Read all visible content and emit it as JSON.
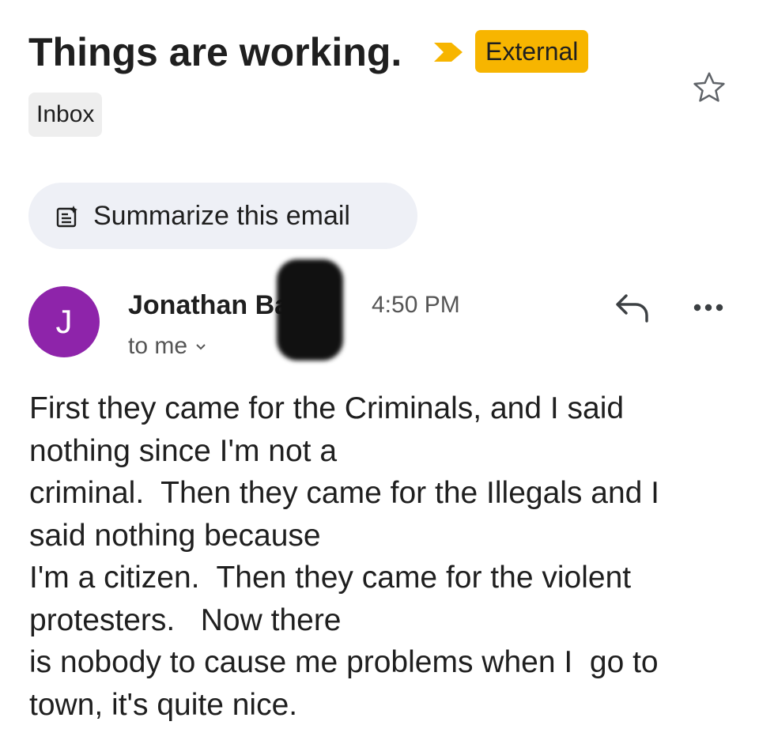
{
  "email": {
    "subject": "Things are working.",
    "importance_icon": "importance-marker-icon",
    "external_label": "External",
    "label_chip": "Inbox",
    "starred": false
  },
  "summarize": {
    "icon": "summarize-icon",
    "label": "Summarize this email"
  },
  "message": {
    "avatar_initial": "J",
    "avatar_color": "#8e24aa",
    "sender_name": "Jonathan Basile",
    "sender_redacted": true,
    "time": "4:50 PM",
    "recipient": "to me",
    "body_lines": [
      "First they came for the Criminals, and I said",
      "nothing since I'm not a",
      "criminal.  Then they came for the Illegals and I",
      "said nothing because",
      "I'm a citizen.  Then they came for the violent",
      "protesters.   Now there",
      "is nobody to cause me problems when I  go to",
      "town, it's quite nice."
    ]
  },
  "colors": {
    "external_badge": "#f7b500",
    "importance_marker": "#f7b500",
    "summarize_bg": "#eef0f6",
    "chip_bg": "#eeeeee"
  }
}
